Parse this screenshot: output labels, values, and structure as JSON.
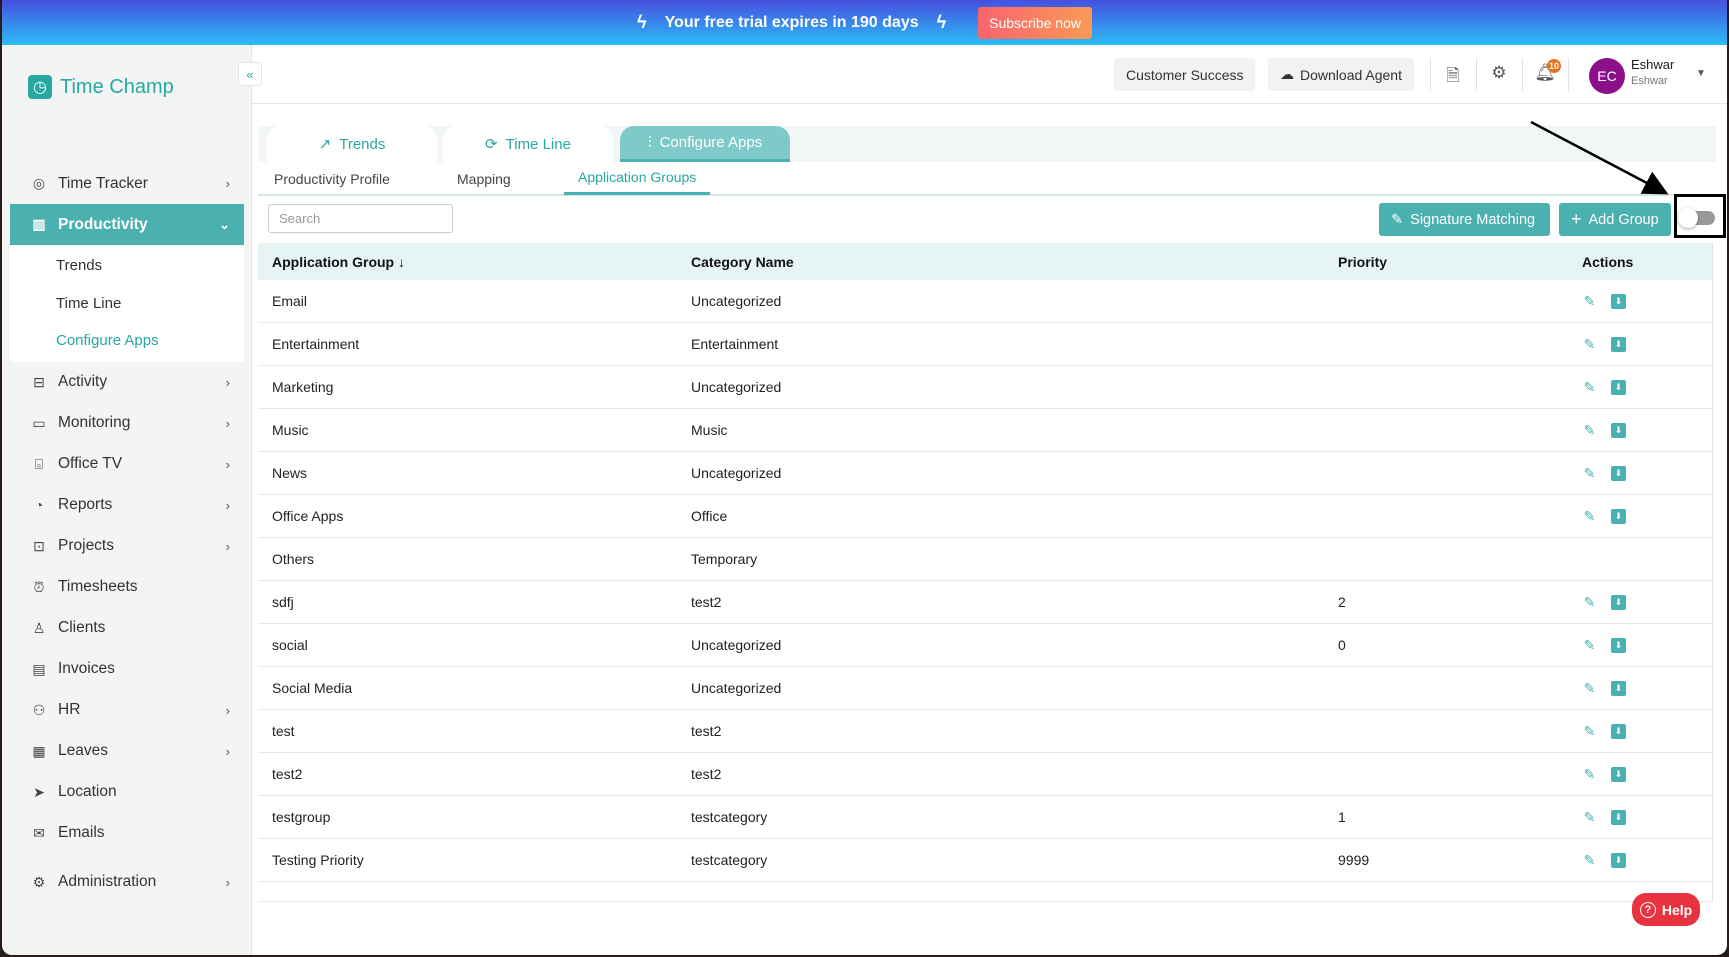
{
  "banner": {
    "text": "Your free trial expires in 190 days",
    "subscribe": "Subscribe now"
  },
  "app": {
    "name": "Time Champ"
  },
  "sidebar": {
    "items": [
      {
        "label": "Time Tracker",
        "icon": "target-icon",
        "chev": true
      },
      {
        "label": "Productivity",
        "icon": "chart-icon",
        "chev": true,
        "active": true
      },
      {
        "label": "Activity",
        "icon": "ticket-icon",
        "chev": true
      },
      {
        "label": "Monitoring",
        "icon": "monitor-icon",
        "chev": true
      },
      {
        "label": "Office TV",
        "icon": "tv-icon",
        "chev": true
      },
      {
        "label": "Reports",
        "icon": "pie-icon",
        "chev": true
      },
      {
        "label": "Projects",
        "icon": "briefcase-icon",
        "chev": true
      },
      {
        "label": "Timesheets",
        "icon": "alarm-icon",
        "chev": false
      },
      {
        "label": "Clients",
        "icon": "user-icon",
        "chev": false
      },
      {
        "label": "Invoices",
        "icon": "invoice-icon",
        "chev": false
      },
      {
        "label": "HR",
        "icon": "hr-icon",
        "chev": true
      },
      {
        "label": "Leaves",
        "icon": "calendar-icon",
        "chev": true
      },
      {
        "label": "Location",
        "icon": "location-icon",
        "chev": false
      },
      {
        "label": "Emails",
        "icon": "mail-icon",
        "chev": false
      },
      {
        "label": "Administration",
        "icon": "gear-icon",
        "chev": true
      }
    ],
    "sub": [
      "Trends",
      "Time Line",
      "Configure Apps"
    ]
  },
  "header": {
    "customer_success": "Customer Success",
    "download_agent": "Download Agent",
    "notifications": "10",
    "avatar": "EC",
    "user_name": "Eshwar",
    "user_sub": "Eshwar"
  },
  "tabs": [
    "Trends",
    "Time Line",
    "Configure Apps"
  ],
  "subtabs": [
    "Productivity Profile",
    "Mapping",
    "Application Groups"
  ],
  "toolbar": {
    "search_placeholder": "Search",
    "signature": "Signature Matching",
    "add_group": "Add Group",
    "toggle_on": false
  },
  "table": {
    "headers": [
      "Application Group",
      "Category Name",
      "Priority",
      "Actions"
    ],
    "rows": [
      [
        "Email",
        "Uncategorized",
        "",
        true
      ],
      [
        "Entertainment",
        "Entertainment",
        "",
        true
      ],
      [
        "Marketing",
        "Uncategorized",
        "",
        true
      ],
      [
        "Music",
        "Music",
        "",
        true
      ],
      [
        "News",
        "Uncategorized",
        "",
        true
      ],
      [
        "Office Apps",
        "Office",
        "",
        true
      ],
      [
        "Others",
        "Temporary",
        "",
        false
      ],
      [
        "sdfj",
        "test2",
        "2",
        true
      ],
      [
        "social",
        "Uncategorized",
        "0",
        true
      ],
      [
        "Social Media",
        "Uncategorized",
        "",
        true
      ],
      [
        "test",
        "test2",
        "",
        true
      ],
      [
        "test2",
        "test2",
        "",
        true
      ],
      [
        "testgroup",
        "testcategory",
        "1",
        true
      ],
      [
        "Testing Priority",
        "testcategory",
        "9999",
        true
      ]
    ]
  },
  "help": "Help",
  "colors": {
    "accent": "#4ab0b0",
    "help": "#e8323f",
    "avatar": "#8b0f8b"
  }
}
